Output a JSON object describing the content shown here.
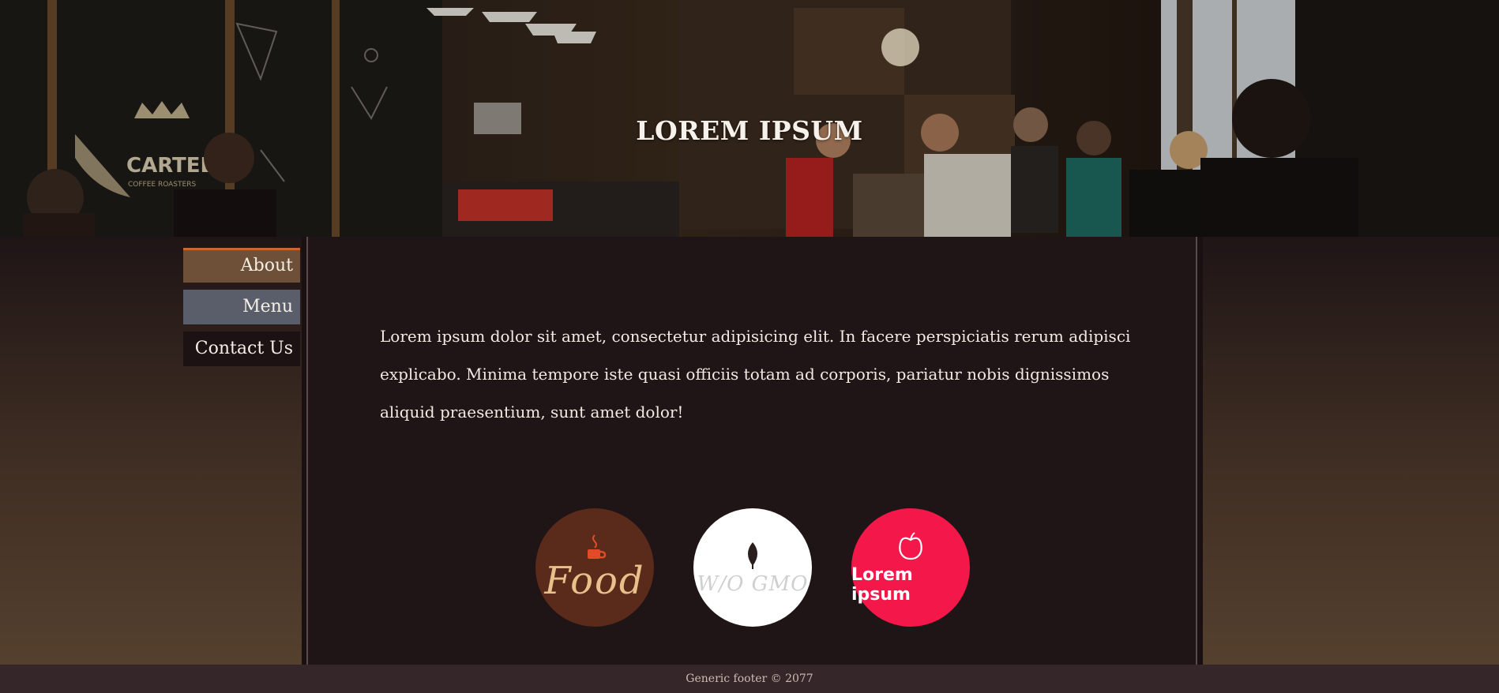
{
  "hero": {
    "title": "LOREM IPSUM",
    "image_description_icon": "cafe-photo",
    "sign_text": "CARTEL",
    "sign_subtext": "COFFEE ROASTERS"
  },
  "nav": {
    "items": [
      {
        "label": "About",
        "active": true
      },
      {
        "label": "Menu"
      },
      {
        "label": "Contact Us"
      }
    ]
  },
  "main": {
    "intro": "Lorem ipsum dolor sit amet, consectetur adipisicing elit. In facere perspiciatis rerum adipisci explicabo. Minima tempore iste quasi officiis totam ad corporis, pariatur nobis dignissimos aliquid praesentium, sunt amet dolor!"
  },
  "badges": [
    {
      "label": "Food",
      "icon": "coffee-cup-icon",
      "color": "#5a2a1a"
    },
    {
      "label": "W/O GMO",
      "icon": "leaf-icon",
      "color": "#ffffff"
    },
    {
      "label": "Lorem ipsum",
      "icon": "apple-icon",
      "color": "#f4184a"
    }
  ],
  "footer": {
    "text": "Generic footer © 2077"
  },
  "colors": {
    "accent": "#d0652f",
    "nav_about": "#6d5037",
    "nav_menu": "#5a5e6a",
    "panel": "#1f1416",
    "footer": "#352729"
  }
}
